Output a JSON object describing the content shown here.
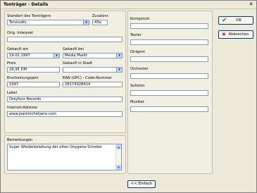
{
  "window": {
    "title": "Tonträger - Details",
    "close_glyph": "✕"
  },
  "left": {
    "standort_label": "Standort des Tonträgers",
    "standort_value": "Tonstudio",
    "zusatznr_label": "Zusatznr.",
    "zusatznr_value": "43a",
    "interpret_label": "Orig. Interpret",
    "interpret_value": "",
    "gekauft_am_label": "Gekauft am",
    "gekauft_am_value": "19.02.1997",
    "gekauft_bei_label": "Gekauft bei",
    "gekauft_bei_value": "Media Markt",
    "preis_label": "Preis",
    "preis_value": "29,95 DM",
    "stadt_label": "Gekauft in Stadt",
    "stadt_value": "",
    "jahr_label": "Erscheinungsjahr",
    "jahr_value": "1997",
    "ean_label": "EAN (UPC) - Code-Nummer",
    "ean_value": "28174328414",
    "label_label": "Label",
    "label_value": "Dreyfuss Records",
    "internet_label": "Internet-Adresse",
    "internet_value": "www.jeanmicheljarre.com"
  },
  "remarks": {
    "label": "Bemerkungen",
    "value": "Super Wiederbelebung der alten Oxygene-Scheibe"
  },
  "right": {
    "komponist_label": "Komponist",
    "texter_label": "Texter",
    "dirigent_label": "Dirigent",
    "orchester_label": "Orchester",
    "solisten_label": "Solisten",
    "musiker_label": "Musiker"
  },
  "buttons": {
    "ok": "OK",
    "abbrechen": "Abbrechen",
    "einfach": "<< Einfach",
    "ok_color": "#2a8a2a",
    "cancel_color": "#c0282c"
  },
  "icons": {
    "dropdown": "▾",
    "up": "▲",
    "down": "▼",
    "check": "✔",
    "cross": "✖"
  }
}
